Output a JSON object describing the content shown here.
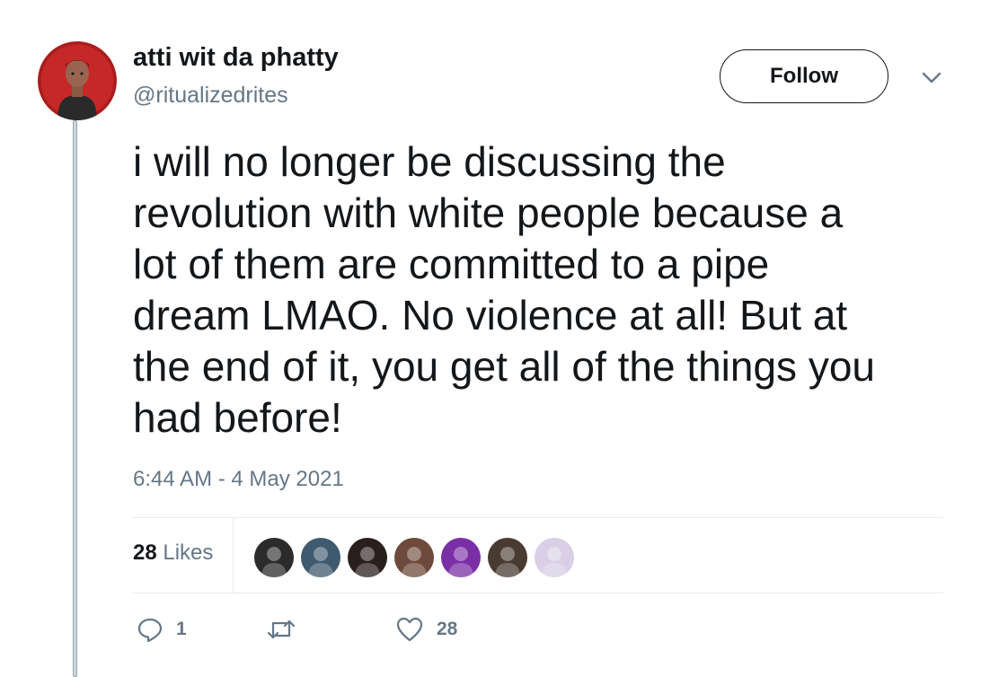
{
  "author": {
    "display_name": "atti wit da phatty",
    "handle": "@ritualizedrites",
    "avatar_icon": "user-avatar",
    "avatar_bg": "#c62828"
  },
  "header": {
    "follow_label": "Follow",
    "menu_icon": "chevron-down-icon"
  },
  "tweet": {
    "text": "i will no longer be discussing the\nrevolution with white people because a\nlot of them are committed to a pipe\ndream LMAO. No violence at all! But at\nthe end of it, you get all of the things you\nhad before!",
    "timestamp": "6:44 AM - 4 May 2021"
  },
  "stats": {
    "likes_count": "28",
    "likes_label": "Likes",
    "likers": [
      {
        "icon": "liker-avatar",
        "bg": "#2b2b2b"
      },
      {
        "icon": "liker-avatar",
        "bg": "#3f5a6e"
      },
      {
        "icon": "liker-avatar",
        "bg": "#2a1f1c"
      },
      {
        "icon": "liker-avatar",
        "bg": "#6e4a3c"
      },
      {
        "icon": "liker-avatar",
        "bg": "#7b2fa6"
      },
      {
        "icon": "liker-avatar",
        "bg": "#4a3b32"
      },
      {
        "icon": "liker-avatar",
        "bg": "#d9cfe6"
      }
    ]
  },
  "actions": {
    "reply_count": "1",
    "retweet_count": "",
    "like_count": "28"
  },
  "colors": {
    "text_primary": "#14171a",
    "text_secondary": "#657786",
    "divider": "#e6ecf0"
  }
}
